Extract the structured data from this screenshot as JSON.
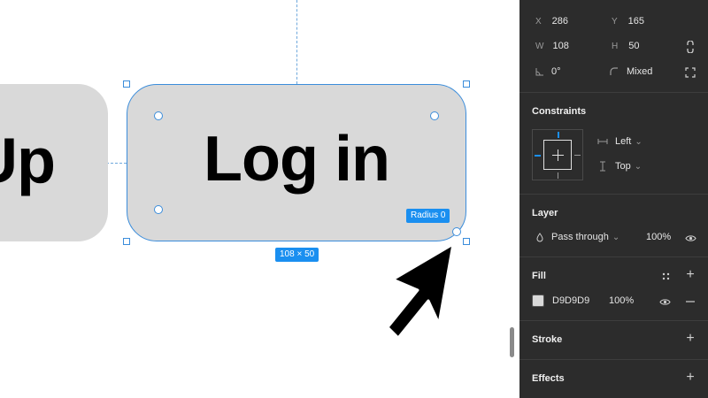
{
  "canvas": {
    "signup_text": "Up",
    "login_text": "Log in",
    "radius_tag": "Radius 0",
    "size_tag": "108 × 50"
  },
  "panel": {
    "x_label": "X",
    "x_value": "286",
    "y_label": "Y",
    "y_value": "165",
    "w_label": "W",
    "w_value": "108",
    "h_label": "H",
    "h_value": "50",
    "rotation_value": "0°",
    "corner_value": "Mixed",
    "constraints_title": "Constraints",
    "constraint_horizontal": "Left",
    "constraint_vertical": "Top",
    "layer_title": "Layer",
    "blend_mode": "Pass through",
    "layer_opacity": "100%",
    "fill_title": "Fill",
    "fill_hex": "D9D9D9",
    "fill_opacity": "100%",
    "stroke_title": "Stroke",
    "effects_title": "Effects"
  },
  "colors": {
    "selection": "#3b8ddb",
    "tag_bg": "#1a8ff0",
    "button_fill": "#d9d9d9",
    "panel_bg": "#2c2c2c"
  }
}
